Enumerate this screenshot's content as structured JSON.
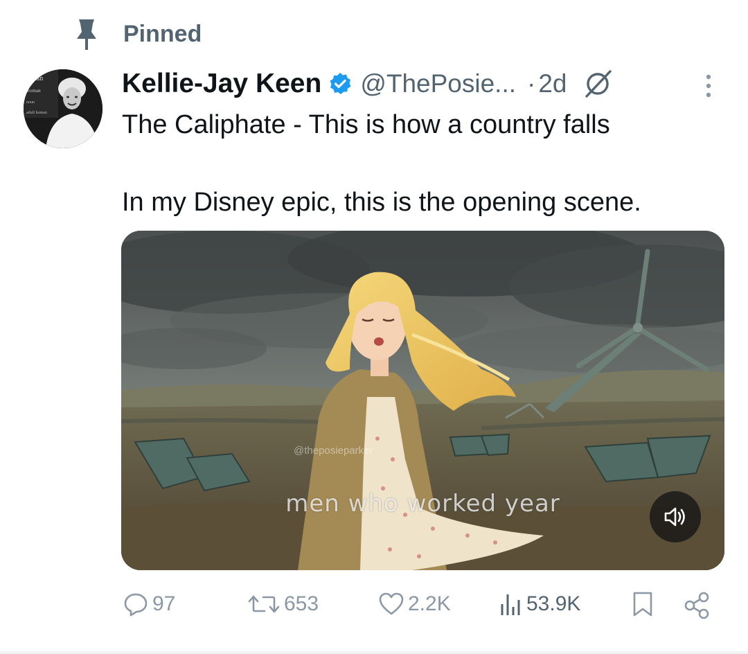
{
  "pinned": {
    "label": "Pinned",
    "icon": "pin-icon"
  },
  "author": {
    "display_name": "Kellie-Jay Keen",
    "handle": "@ThePosie...",
    "verified": true,
    "avatar_icon": "avatar",
    "avatar_caption_lines": [
      "oman",
      "woman",
      "noun",
      "adult human"
    ]
  },
  "meta": {
    "separator": "·",
    "time": "2d",
    "hide_icon": "hide-icon",
    "more_icon": "more-vertical-icon"
  },
  "tweet": {
    "line1": "The Caliphate - This is how a country falls",
    "line2": "In my Disney epic, this is the opening scene."
  },
  "media": {
    "watermark": "@theposieparker",
    "subtitle": "men who worked year",
    "sound_icon": "volume-icon"
  },
  "actions": {
    "replies": "97",
    "reposts": "653",
    "likes": "2.2K",
    "views": "53.9K"
  },
  "colors": {
    "text": "#0f1419",
    "secondary": "#536471",
    "muted": "#8b98a5",
    "verified": "#1d9bf0"
  }
}
